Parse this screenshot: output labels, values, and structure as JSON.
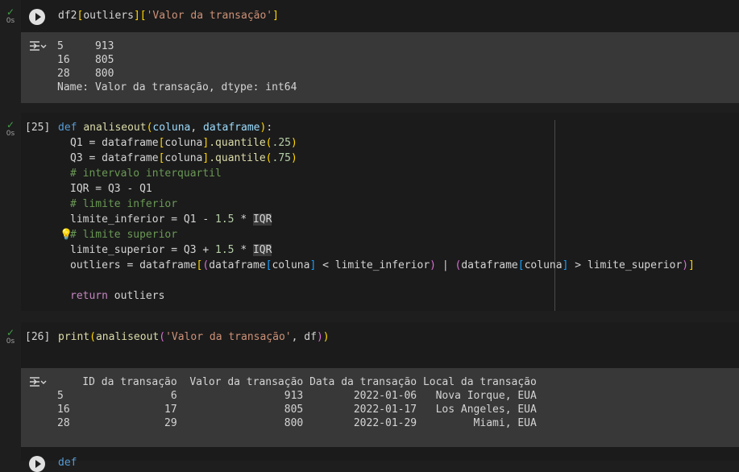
{
  "cells": {
    "c1": {
      "time": "0s",
      "code": {
        "df": "df2",
        "key": "outliers",
        "col": "'Valor da transação'"
      },
      "output": [
        "5     913",
        "16    805",
        "28    800",
        "Name: Valor da transação, dtype: int64"
      ]
    },
    "c2": {
      "time": "0s",
      "exec": "[25]",
      "lines": {
        "def": "def",
        "fname": "analiseout",
        "p1": "coluna",
        "comma": ", ",
        "p2": "dataframe",
        "colon": ":",
        "q1_name": "Q1",
        "eq": " = ",
        "dataframe": "dataframe",
        "coluna": "coluna",
        "quantile": ".quantile",
        "n25": ".25",
        "n75": ".75",
        "q3_name": "Q3",
        "cmt_iqr": "# intervalo interquartil",
        "iqr_line": "IQR = Q3 - Q1",
        "cmt_inf": "# limite inferior",
        "inf_line": "limite_inferior = Q1 - ",
        "n15": "1.5",
        "times": " * ",
        "iqr": "IQR",
        "cmt_sup": "# limite superior",
        "sup_line": "limite_superior = Q3 + ",
        "out_line": "outliers = ",
        "lt": " < limite_inferior",
        "pipe": " | ",
        "gt": " > limite_superior",
        "ret": "return",
        "ret_val": " outliers"
      }
    },
    "c3": {
      "time": "0s",
      "exec": "[26]",
      "code": {
        "print": "print",
        "fn": "analiseout",
        "arg": "'Valor da transação'",
        "sep": ", ",
        "df": "df"
      },
      "output": [
        "    ID da transação  Valor da transação Data da transação Local da transação",
        "5                 6                 913        2022-01-06   Nova Iorque, EUA",
        "16               17                 805        2022-01-17   Los Angeles, EUA",
        "28               29                 800        2022-01-29         Miami, EUA"
      ]
    },
    "c4": {
      "partial": "def"
    }
  }
}
